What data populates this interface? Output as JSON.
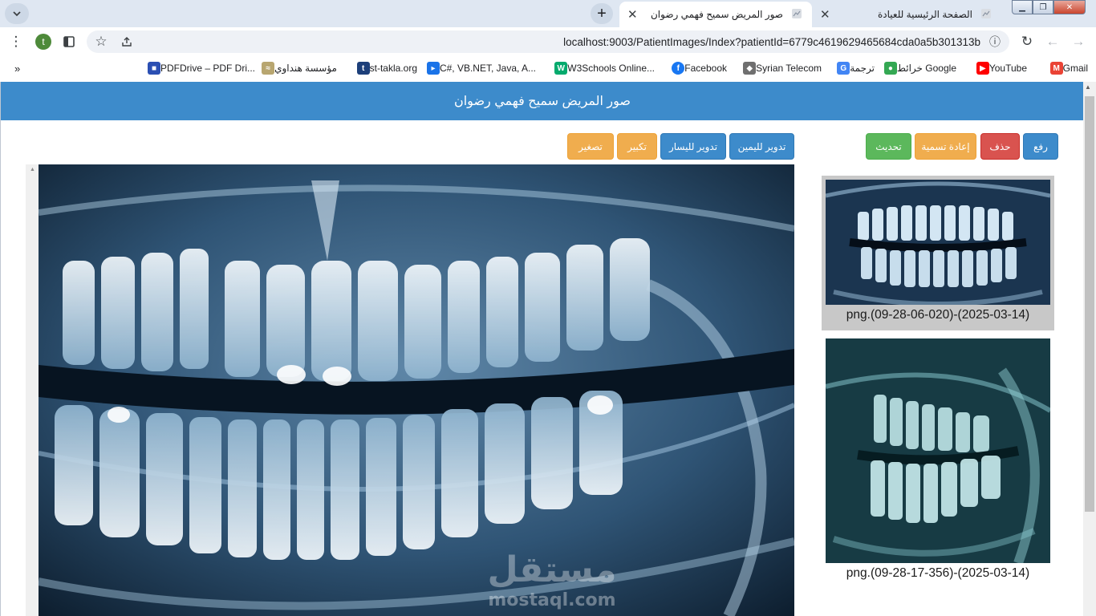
{
  "browser": {
    "tabs": [
      {
        "title": "صور المريض سميح فهمي رضوان",
        "active": true
      },
      {
        "title": "الصفحة الرئيسية للعيادة",
        "active": false
      }
    ],
    "url": "localhost:9003/PatientImages/Index?patientId=6779c4619629465684cda0a5b301313b",
    "profile_initial": "t",
    "bookmarks": [
      {
        "label": "Gmail",
        "icon": "gmail-icon",
        "color": "#ea4335"
      },
      {
        "label": "YouTube",
        "icon": "youtube-icon",
        "color": "#ff0000"
      },
      {
        "label": "خرائط Google",
        "icon": "maps-icon",
        "color": "#34a853"
      },
      {
        "label": "ترجمة",
        "icon": "translate-icon",
        "color": "#4285f4"
      },
      {
        "label": "Syrian Telecom",
        "icon": "syrian-telecom-icon",
        "color": "#6f6f6f"
      },
      {
        "label": "Facebook",
        "icon": "facebook-icon",
        "color": "#1877f2"
      },
      {
        "label": "W3Schools Online...",
        "icon": "w3schools-icon",
        "color": "#04aa6d"
      },
      {
        "label": "C#, VB.NET, Java, A...",
        "icon": "code-site-icon",
        "color": "#1a73e8"
      },
      {
        "label": "st-takla.org",
        "icon": "st-takla-icon",
        "color": "#1d3f7a"
      },
      {
        "label": "مؤسسة هنداوي",
        "icon": "hindawi-icon",
        "color": "#b8a670"
      },
      {
        "label": "PDFDrive – PDF Dri...",
        "icon": "pdfdrive-icon",
        "color": "#2b4fb3"
      }
    ],
    "bookmarks_overflow": "»"
  },
  "page": {
    "title": "صور المريض سميح فهمي رضوان",
    "left_actions": {
      "upload": "رفع",
      "delete": "حذف",
      "rename": "إعادة تسمية",
      "refresh": "تحديث"
    },
    "viewer_actions": {
      "rotate_right": "تدوير لليمين",
      "rotate_left": "تدوير لليسار",
      "zoom_in": "تكبير",
      "zoom_out": "تصغير"
    },
    "thumbnails": [
      {
        "caption": "(2025-03-14)-(09-28-06-020).png",
        "selected": true
      },
      {
        "caption": "(2025-03-14)-(09-28-17-356).png",
        "selected": false
      }
    ],
    "watermark": {
      "arabic": "مستقل",
      "latin": "mostaql.com"
    }
  },
  "colors": {
    "header": "#3d8bcb",
    "primary": "#3d8bcb",
    "danger": "#d9534f",
    "warning": "#f0ad4e",
    "success": "#5cb85c",
    "xray_dark": "#0d1e2e",
    "xray_light": "#cfe4f2"
  }
}
